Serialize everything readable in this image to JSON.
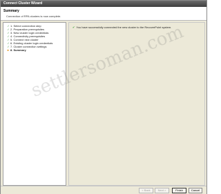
{
  "window": {
    "title": "Connect Cluster Wizard"
  },
  "header": {
    "title": "Summary",
    "subtitle": "Connection of RPA clusters is now complete."
  },
  "steps": [
    {
      "label": "1. Select connection step",
      "status": "done"
    },
    {
      "label": "2. Preparation prerequisites",
      "status": "done"
    },
    {
      "label": "3. New cluster login credentials",
      "status": "done"
    },
    {
      "label": "4. Connectivity prerequisites",
      "status": "done"
    },
    {
      "label": "5. Connect new cluster",
      "status": "done"
    },
    {
      "label": "6. Existing cluster login credentials",
      "status": "done"
    },
    {
      "label": "7. Cluster connection settings",
      "status": "done"
    },
    {
      "label": "8. Summary",
      "status": "current"
    }
  ],
  "main": {
    "message": "You have successfully connected the new cluster to the RecoverPoint system."
  },
  "buttons": {
    "back": "< Back",
    "next": "Next >",
    "finish": "Finish",
    "cancel": "Cancel"
  },
  "watermark": "settlersoman.com"
}
